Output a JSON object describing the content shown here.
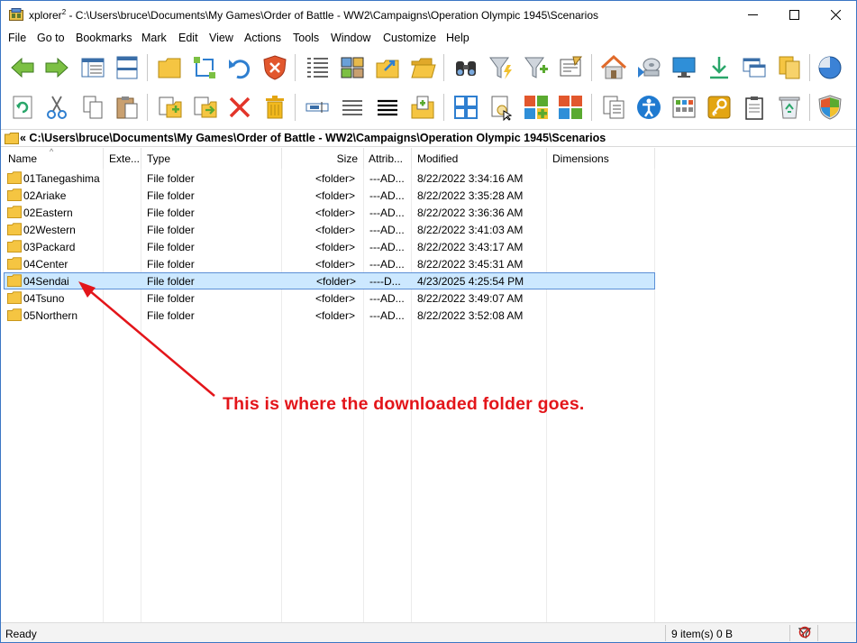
{
  "window": {
    "app_name": "xplorer",
    "app_sup": "2",
    "title_path": " - C:\\Users\\bruce\\Documents\\My Games\\Order of Battle - WW2\\Campaigns\\Operation Olympic 1945\\Scenarios"
  },
  "menu": [
    "File",
    "Go to",
    "Bookmarks",
    "Mark",
    "Edit",
    "View",
    "Actions",
    "Tools",
    "Window",
    "Customize",
    "Help"
  ],
  "address": {
    "path": "« C:\\Users\\bruce\\Documents\\My Games\\Order of Battle - WW2\\Campaigns\\Operation Olympic 1945\\Scenarios"
  },
  "columns": [
    "Name",
    "Exte...",
    "Type",
    "Size",
    "Attrib...",
    "Modified",
    "Dimensions"
  ],
  "rows": [
    {
      "name": "01Tanegashima",
      "type": "File folder",
      "size": "<folder>",
      "attrib": "---AD...",
      "modified": "8/22/2022 3:34:16 AM"
    },
    {
      "name": "02Ariake",
      "type": "File folder",
      "size": "<folder>",
      "attrib": "---AD...",
      "modified": "8/22/2022 3:35:28 AM"
    },
    {
      "name": "02Eastern",
      "type": "File folder",
      "size": "<folder>",
      "attrib": "---AD...",
      "modified": "8/22/2022 3:36:36 AM"
    },
    {
      "name": "02Western",
      "type": "File folder",
      "size": "<folder>",
      "attrib": "---AD...",
      "modified": "8/22/2022 3:41:03 AM"
    },
    {
      "name": "03Packard",
      "type": "File folder",
      "size": "<folder>",
      "attrib": "---AD...",
      "modified": "8/22/2022 3:43:17 AM"
    },
    {
      "name": "04Center",
      "type": "File folder",
      "size": "<folder>",
      "attrib": "---AD...",
      "modified": "8/22/2022 3:45:31 AM"
    },
    {
      "name": "04Sendai",
      "type": "File folder",
      "size": "<folder>",
      "attrib": "----D...",
      "modified": "4/23/2025 4:25:54 PM"
    },
    {
      "name": "04Tsuno",
      "type": "File folder",
      "size": "<folder>",
      "attrib": "---AD...",
      "modified": "8/22/2022 3:49:07 AM"
    },
    {
      "name": "05Northern",
      "type": "File folder",
      "size": "<folder>",
      "attrib": "---AD...",
      "modified": "8/22/2022 3:52:08 AM"
    }
  ],
  "selected_row": "04Sendai",
  "annotation": {
    "text": "This is where the downloaded folder goes.",
    "color": "#e3151a"
  },
  "status": {
    "left": "Ready",
    "right": "9 item(s) 0 B"
  },
  "colors": {
    "selection_bg": "#cce8ff",
    "selection_border": "#5b8fd6",
    "folder": "#f5c542"
  }
}
